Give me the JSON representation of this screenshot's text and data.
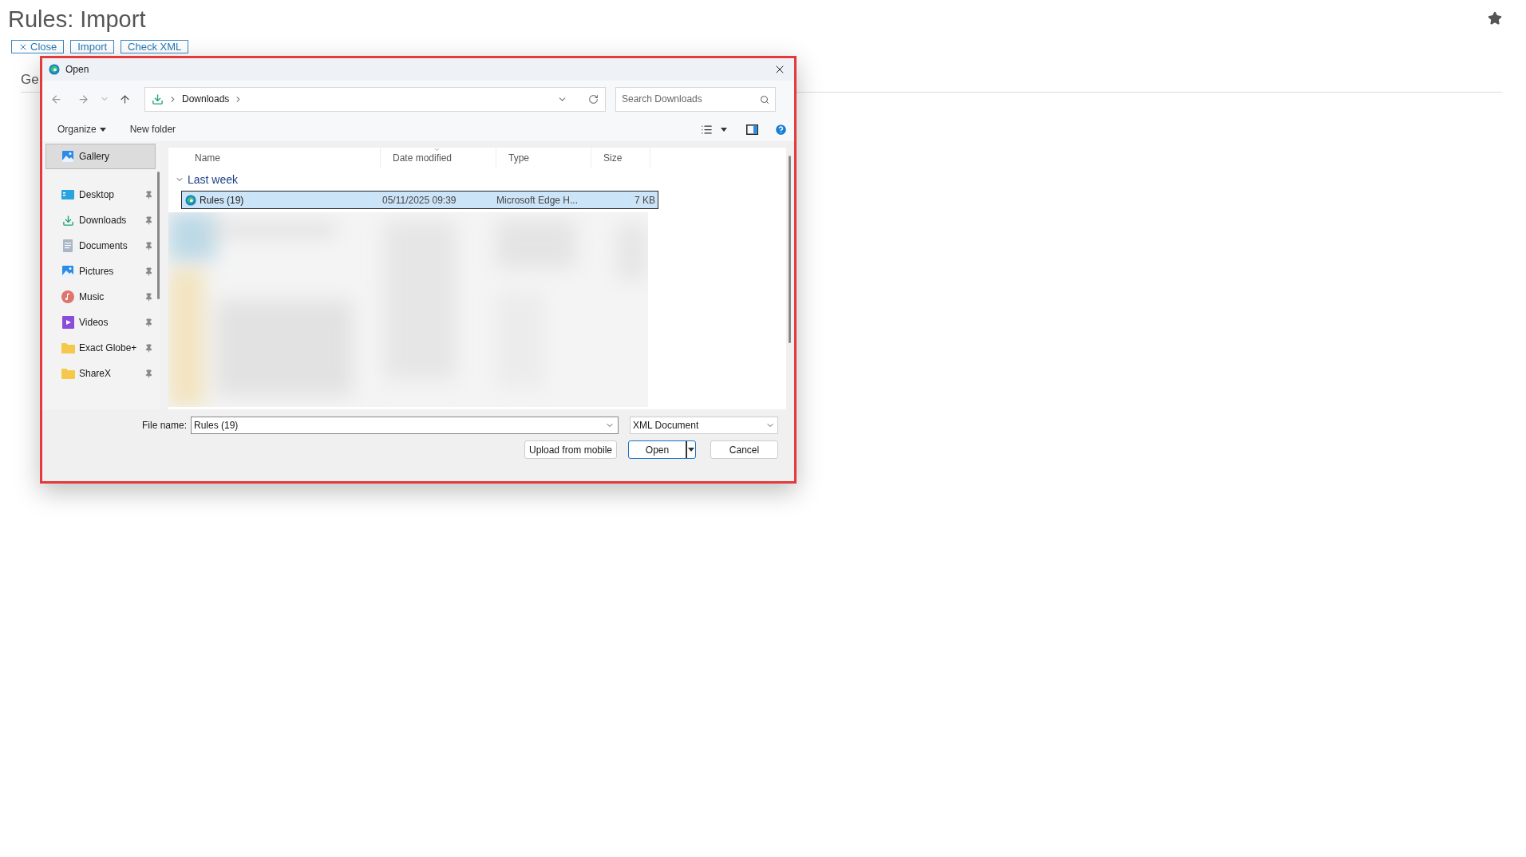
{
  "page": {
    "title": "Rules: Import",
    "actions": [
      {
        "label": "Close",
        "kind": "close"
      },
      {
        "label": "Import",
        "kind": "plain"
      },
      {
        "label": "Check XML",
        "kind": "plain"
      }
    ],
    "tab_label": "Ge"
  },
  "dialog": {
    "title": "Open",
    "breadcrumb": [
      "Downloads"
    ],
    "search": {
      "placeholder": "Search Downloads"
    },
    "toolbar": [
      {
        "label": "Organize",
        "kind": "menu"
      },
      {
        "label": "New folder",
        "kind": "plain"
      }
    ],
    "sidebar": [
      {
        "label": "Gallery",
        "kind": "gallery",
        "selected": true,
        "pinned": false
      },
      {
        "label": "Desktop",
        "kind": "desktop",
        "selected": false,
        "pinned": true
      },
      {
        "label": "Downloads",
        "kind": "downloads",
        "selected": false,
        "pinned": true
      },
      {
        "label": "Documents",
        "kind": "documents",
        "selected": false,
        "pinned": true
      },
      {
        "label": "Pictures",
        "kind": "pictures",
        "selected": false,
        "pinned": true
      },
      {
        "label": "Music",
        "kind": "music",
        "selected": false,
        "pinned": true
      },
      {
        "label": "Videos",
        "kind": "videos",
        "selected": false,
        "pinned": true
      },
      {
        "label": "Exact Globe+",
        "kind": "folder",
        "selected": false,
        "pinned": true
      },
      {
        "label": "ShareX",
        "kind": "folder",
        "selected": false,
        "pinned": true
      }
    ],
    "columns": [
      {
        "label": "Name",
        "sorted": false
      },
      {
        "label": "Date modified",
        "sorted": true
      },
      {
        "label": "Type",
        "sorted": false
      },
      {
        "label": "Size",
        "sorted": false
      }
    ],
    "groups": [
      {
        "label": "Last week",
        "expanded": true,
        "files": [
          {
            "name": "Rules (19)",
            "date": "05/11/2025 09:39",
            "type": "Microsoft Edge H...",
            "size": "7 KB",
            "selected": true
          }
        ]
      }
    ],
    "file_name": {
      "label": "File name:",
      "value": "Rules (19)"
    },
    "file_type": "XML Document",
    "buttons": [
      {
        "label": "Upload from mobile",
        "kind": "secondary"
      },
      {
        "label": "Open",
        "kind": "split"
      },
      {
        "label": "Cancel",
        "kind": "secondary"
      }
    ]
  }
}
